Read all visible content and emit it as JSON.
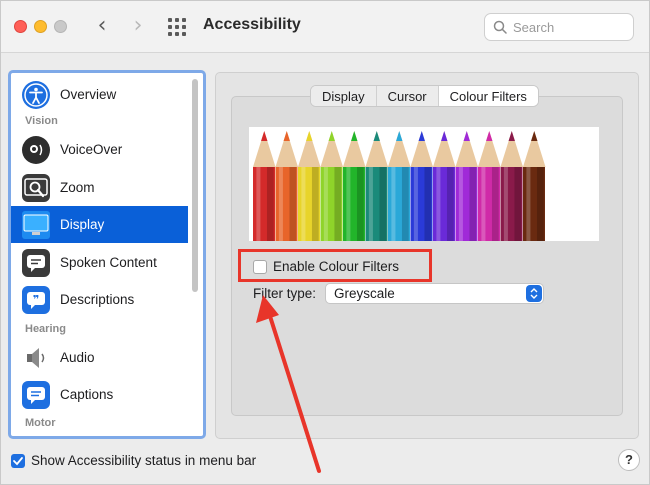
{
  "window": {
    "title": "Accessibility"
  },
  "toolbar": {
    "search_placeholder": "Search",
    "back_icon": "‹",
    "forward_icon": "›"
  },
  "sidebar": {
    "items": [
      {
        "label": "Overview",
        "icon": "overview-icon"
      },
      {
        "label": "VoiceOver",
        "icon": "voiceover-icon"
      },
      {
        "label": "Zoom",
        "icon": "zoom-icon"
      },
      {
        "label": "Display",
        "icon": "display-icon",
        "selected": true
      },
      {
        "label": "Spoken Content",
        "icon": "speech-bubble-icon"
      },
      {
        "label": "Descriptions",
        "icon": "quote-bubble-icon"
      },
      {
        "label": "Audio",
        "icon": "speaker-icon"
      },
      {
        "label": "Captions",
        "icon": "captions-icon"
      }
    ],
    "sections": [
      "Vision",
      "Hearing",
      "Motor"
    ]
  },
  "tabs": [
    "Display",
    "Cursor",
    "Colour Filters"
  ],
  "active_tab": "Colour Filters",
  "filters": {
    "enable_label": "Enable Colour Filters",
    "enabled": false,
    "filter_type_label": "Filter type:",
    "filter_type_value": "Greyscale"
  },
  "pencil_colors": [
    "#d42a2a",
    "#e8642a",
    "#e8d42a",
    "#8fd42a",
    "#22b52a",
    "#1a8a7a",
    "#2aa8d8",
    "#2a3ad8",
    "#6a2ad8",
    "#a02ad8",
    "#d02aa8",
    "#8a1a4a",
    "#6a2a10"
  ],
  "footer": {
    "show_status_label": "Show Accessibility status in menu bar",
    "show_status_checked": true,
    "help_label": "?"
  },
  "colors": {
    "accent": "#1e6fe0",
    "selection": "#0a60d8",
    "highlight_red": "#e8352a"
  }
}
